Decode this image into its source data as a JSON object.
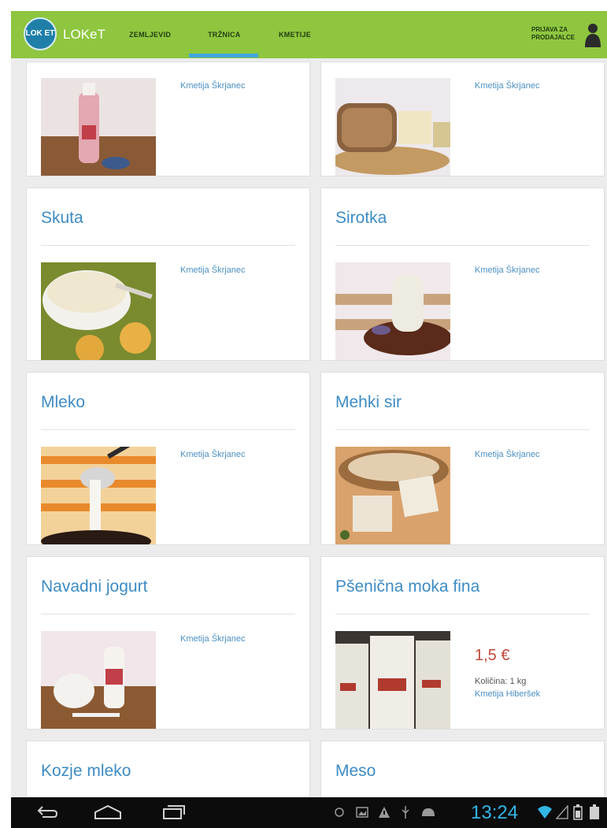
{
  "app": {
    "logo_text": "LOK ET",
    "brand": "LOKeT"
  },
  "nav": {
    "items": [
      {
        "label": "ZEMLJEVID"
      },
      {
        "label": "TRŽNICA"
      },
      {
        "label": "KMETIJE"
      }
    ],
    "active": "TRŽNICA"
  },
  "login": {
    "label": "PRIJAVA ZA PRODAJALCE"
  },
  "products": [
    {
      "title": "",
      "farm": "Kmetija Škrjanec"
    },
    {
      "title": "",
      "farm": "Kmetija Škrjanec"
    },
    {
      "title": "Skuta",
      "farm": "Kmetija Škrjanec"
    },
    {
      "title": "Sirotka",
      "farm": "Kmetija Škrjanec"
    },
    {
      "title": "Mleko",
      "farm": "Kmetija Škrjanec"
    },
    {
      "title": "Mehki sir",
      "farm": "Kmetija Škrjanec"
    },
    {
      "title": "Navadni jogurt",
      "farm": "Kmetija Škrjanec"
    },
    {
      "title": "Pšenična moka fina",
      "price": "1,5 €",
      "quantity": "Količina: 1 kg",
      "farm": "Kmetija Hiberšek"
    },
    {
      "title": "Kozje mleko"
    },
    {
      "title": "Meso"
    }
  ],
  "system": {
    "time": "13:24"
  },
  "colors": {
    "topbar": "#8ec63f",
    "accent_blue": "#3d8cc4",
    "price_red": "#c24a3b",
    "sysbar": "#0c0c0c"
  }
}
